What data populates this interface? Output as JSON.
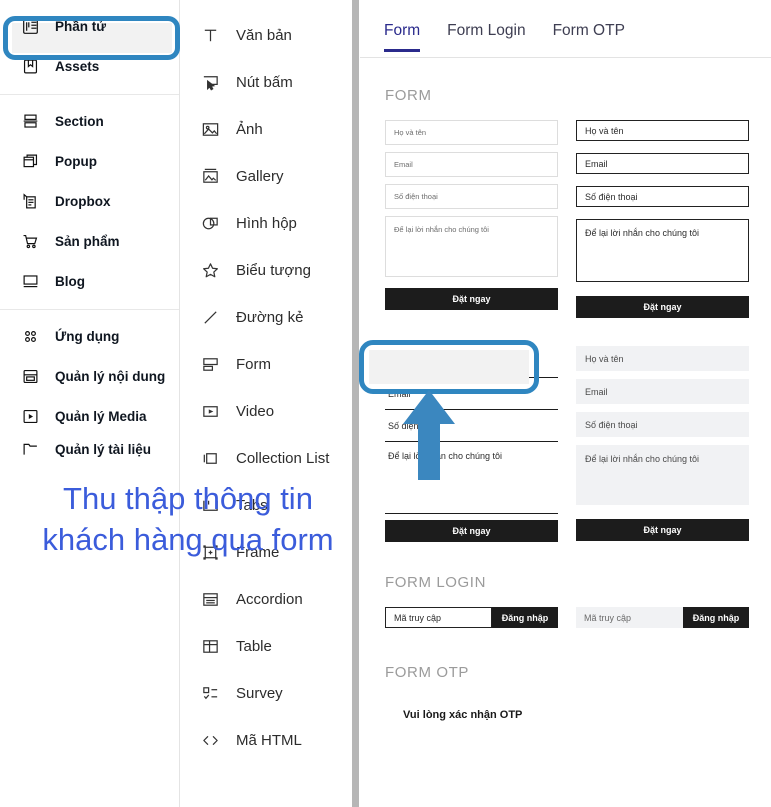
{
  "sidebar": {
    "groups": [
      {
        "items": [
          {
            "label": "Phần tử",
            "icon": "elements-icon",
            "active": true
          },
          {
            "label": "Assets",
            "icon": "bookmark-icon",
            "active": false
          }
        ]
      },
      {
        "items": [
          {
            "label": "Section",
            "icon": "section-icon",
            "active": false
          },
          {
            "label": "Popup",
            "icon": "popup-icon",
            "active": false
          },
          {
            "label": "Dropbox",
            "icon": "dropbox-icon",
            "active": false
          },
          {
            "label": "Sản phẩm",
            "icon": "cart-icon",
            "active": false
          },
          {
            "label": "Blog",
            "icon": "monitor-icon",
            "active": false
          }
        ]
      },
      {
        "items": [
          {
            "label": "Ứng dụng",
            "icon": "apps-grid-icon",
            "active": false
          },
          {
            "label": "Quản lý nội dung",
            "icon": "content-manager-icon",
            "active": false
          },
          {
            "label": "Quản lý Media",
            "icon": "media-manager-icon",
            "active": false
          },
          {
            "label": "Quản lý tài liệu",
            "icon": "folder-icon",
            "active": false
          }
        ]
      }
    ]
  },
  "elements": {
    "items": [
      {
        "label": "Văn bản",
        "icon": "text-icon",
        "active": false
      },
      {
        "label": "Nút bấm",
        "icon": "button-cursor-icon",
        "active": false
      },
      {
        "label": "Ảnh",
        "icon": "image-icon",
        "active": false
      },
      {
        "label": "Gallery",
        "icon": "gallery-icon",
        "active": false
      },
      {
        "label": "Hình hộp",
        "icon": "shape-box-icon",
        "active": false
      },
      {
        "label": "Biểu tượng",
        "icon": "star-icon",
        "active": false
      },
      {
        "label": "Đường kẻ",
        "icon": "line-icon",
        "active": false
      },
      {
        "label": "Form",
        "icon": "form-icon",
        "active": true
      },
      {
        "label": "Video",
        "icon": "video-play-icon",
        "active": false
      },
      {
        "label": "Collection List",
        "icon": "collection-list-icon",
        "active": false
      },
      {
        "label": "Tabs",
        "icon": "tabs-icon",
        "active": false
      },
      {
        "label": "Frame",
        "icon": "frame-icon",
        "active": false
      },
      {
        "label": "Accordion",
        "icon": "accordion-icon",
        "active": false
      },
      {
        "label": "Table",
        "icon": "table-icon",
        "active": false
      },
      {
        "label": "Survey",
        "icon": "survey-icon",
        "active": false
      },
      {
        "label": "Mã HTML",
        "icon": "code-icon",
        "active": false
      }
    ]
  },
  "annotation": {
    "line1": "Thu thập thông tin",
    "line2": "khách hàng qua form",
    "color": "#3b5cdb"
  },
  "highlight": {
    "color": "#2f86c0"
  },
  "preview": {
    "tabs": [
      {
        "label": "Form",
        "active": true
      },
      {
        "label": "Form Login",
        "active": false
      },
      {
        "label": "Form OTP",
        "active": false
      }
    ],
    "sections": {
      "form": "FORM",
      "form_login": "FORM LOGIN",
      "form_otp": "FORM OTP"
    },
    "fields": {
      "name": "Họ và tên",
      "email": "Email",
      "phone": "Số điện thoại",
      "message": "Để lại lời nhắn cho chúng tôi"
    },
    "submit_label": "Đặt ngay",
    "login": {
      "access_code": "Mã truy cập",
      "login_label": "Đăng nhập"
    },
    "otp": {
      "heading": "Vui lòng xác nhận OTP"
    }
  }
}
